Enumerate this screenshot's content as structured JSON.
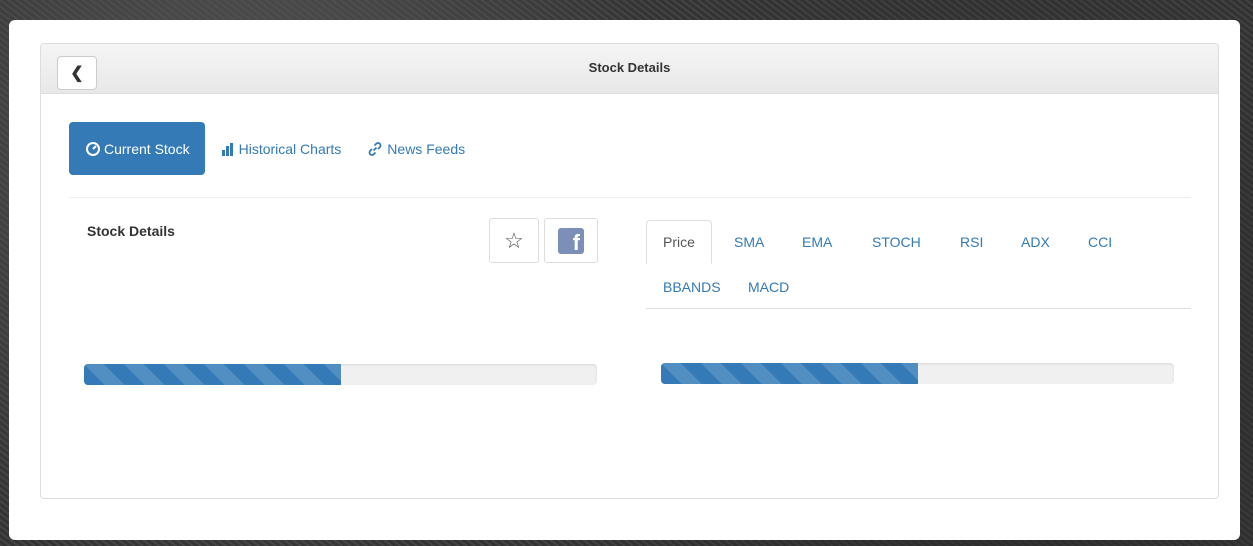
{
  "header": {
    "back_icon": "chevron-left-icon",
    "back_glyph": "❮",
    "title": "Stock Details"
  },
  "nav": {
    "pills": [
      {
        "label": "Current Stock",
        "icon": "dashboard-icon",
        "active": true
      },
      {
        "label": "Historical Charts",
        "icon": "bar-chart-icon",
        "active": false
      },
      {
        "label": "News Feeds",
        "icon": "link-icon",
        "active": false
      }
    ]
  },
  "details": {
    "title": "Stock Details",
    "favorite_icon": "star-outline-icon",
    "favorite_glyph": "☆",
    "share_icon": "facebook-icon",
    "share_glyph": "f",
    "progress": 0.5
  },
  "chart_tabs": {
    "tabs": [
      "Price",
      "SMA",
      "EMA",
      "STOCH",
      "RSI",
      "ADX",
      "CCI",
      "BBANDS",
      "MACD"
    ],
    "active": "Price",
    "progress": 0.5
  },
  "colors": {
    "accent": "#337ab7",
    "facebook": "#7b8fb8"
  }
}
